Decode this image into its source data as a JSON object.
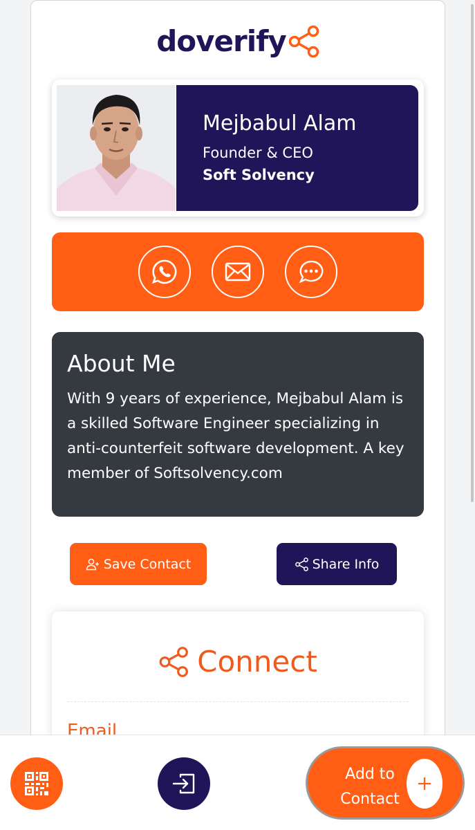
{
  "brand": {
    "logo_text": "doverify",
    "accent": "#ff5e14",
    "primary": "#201558"
  },
  "profile": {
    "name": "Mejbabul Alam",
    "title": "Founder & CEO",
    "company": "Soft Solvency"
  },
  "actions": [
    {
      "icon": "whatsapp-icon"
    },
    {
      "icon": "mail-icon"
    },
    {
      "icon": "chat-icon"
    }
  ],
  "about": {
    "heading": "About Me",
    "text": "With 9 years of experience, Mejbabul Alam is a skilled Software Engineer specializing in anti-counterfeit software development. A key member of Softsolvency.com"
  },
  "buttons": {
    "save_contact": "Save Contact",
    "share_info": "Share Info"
  },
  "connect": {
    "heading": "Connect",
    "first_label": "Email"
  },
  "bottom_bar": {
    "add_contact_line1": "Add to",
    "add_contact_line2": "Contact",
    "add_icon": "+"
  }
}
